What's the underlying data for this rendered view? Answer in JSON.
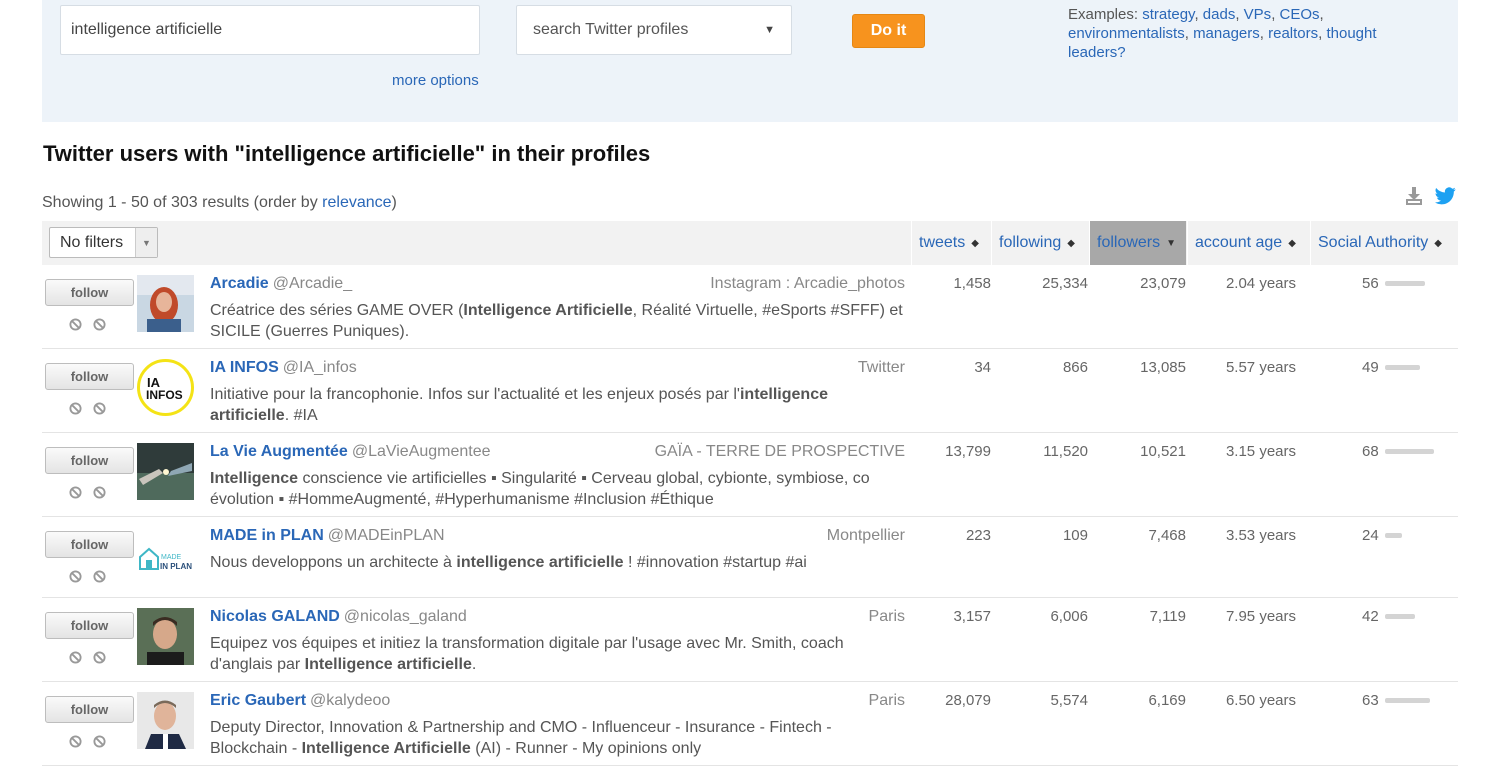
{
  "search": {
    "query": "intelligence artificielle",
    "type_label": "search Twitter profiles",
    "submit_label": "Do it",
    "more_options": "more options",
    "examples_label": "Examples:",
    "examples": [
      "strategy",
      "dads",
      "VPs",
      "CEOs",
      "environmentalists",
      "managers",
      "realtors",
      "thought leaders?"
    ]
  },
  "results": {
    "title": "Twitter users with \"intelligence artificielle\" in their profiles",
    "showing_prefix": "Showing 1 - 50 of 303 results (order by ",
    "order_link": "relevance",
    "showing_suffix": ")"
  },
  "table": {
    "filter_label": "No filters",
    "columns": {
      "tweets": "tweets",
      "following": "following",
      "followers": "followers",
      "account_age": "account age",
      "social_authority": "Social Authority"
    },
    "follow_label": "follow",
    "rows": [
      {
        "name": "Arcadie",
        "handle": "@Arcadie_",
        "location": "Instagram : Arcadie_photos",
        "bio": [
          {
            "t": "Créatrice des séries GAME OVER (",
            "b": false
          },
          {
            "t": "Intelligence Artificielle",
            "b": true
          },
          {
            "t": ", Réalité Virtuelle, #eSports #SFFF) et SICILE (Guerres Puniques).",
            "b": false
          }
        ],
        "tweets": "1,458",
        "following": "25,334",
        "followers": "23,079",
        "age": "2.04 years",
        "sa": 56
      },
      {
        "name": "IA INFOS",
        "handle": "@IA_infos",
        "location": "Twitter",
        "bio": [
          {
            "t": "Initiative pour la francophonie. Infos sur l'actualité et les enjeux posés par l'",
            "b": false
          },
          {
            "t": "intelligence artificielle",
            "b": true
          },
          {
            "t": ". #IA",
            "b": false
          }
        ],
        "tweets": "34",
        "following": "866",
        "followers": "13,085",
        "age": "5.57 years",
        "sa": 49
      },
      {
        "name": "La Vie Augmentée",
        "handle": "@LaVieAugmentee",
        "location": "GAÏA - TERRE DE PROSPECTIVE",
        "bio": [
          {
            "t": "Intelligence",
            "b": true
          },
          {
            "t": " conscience vie artificielles ▪ Singularité ▪ Cerveau global, cybionte, symbiose, co évolution ▪ #HommeAugmenté, #Hyperhumanisme #Inclusion #Éthique",
            "b": false
          }
        ],
        "tweets": "13,799",
        "following": "11,520",
        "followers": "10,521",
        "age": "3.15 years",
        "sa": 68
      },
      {
        "name": "MADE in PLAN",
        "handle": "@MADEinPLAN",
        "location": "Montpellier",
        "bio": [
          {
            "t": "Nous developpons un architecte à ",
            "b": false
          },
          {
            "t": "intelligence artificielle",
            "b": true
          },
          {
            "t": " ! #innovation #startup #ai",
            "b": false
          }
        ],
        "tweets": "223",
        "following": "109",
        "followers": "7,468",
        "age": "3.53 years",
        "sa": 24
      },
      {
        "name": "Nicolas GALAND",
        "handle": "@nicolas_galand",
        "location": "Paris",
        "bio": [
          {
            "t": "Equipez vos équipes et initiez la transformation digitale par l'usage avec Mr. Smith, coach d'anglais par ",
            "b": false
          },
          {
            "t": "Intelligence artificielle",
            "b": true
          },
          {
            "t": ".",
            "b": false
          }
        ],
        "tweets": "3,157",
        "following": "6,006",
        "followers": "7,119",
        "age": "7.95 years",
        "sa": 42
      },
      {
        "name": "Eric Gaubert",
        "handle": "@kalydeoo",
        "location": "Paris",
        "bio": [
          {
            "t": "Deputy Director, Innovation & Partnership and CMO - Influenceur - Insurance - Fintech - Blockchain - ",
            "b": false
          },
          {
            "t": "Intelligence Artificielle",
            "b": true
          },
          {
            "t": " (AI) - Runner - My opinions only",
            "b": false
          }
        ],
        "tweets": "28,079",
        "following": "5,574",
        "followers": "6,169",
        "age": "6.50 years",
        "sa": 63
      }
    ]
  },
  "colors": {
    "link": "#2a67b7",
    "button": "#f7931e",
    "panel": "#edf3f9",
    "active_column": "#a8a8a8"
  }
}
